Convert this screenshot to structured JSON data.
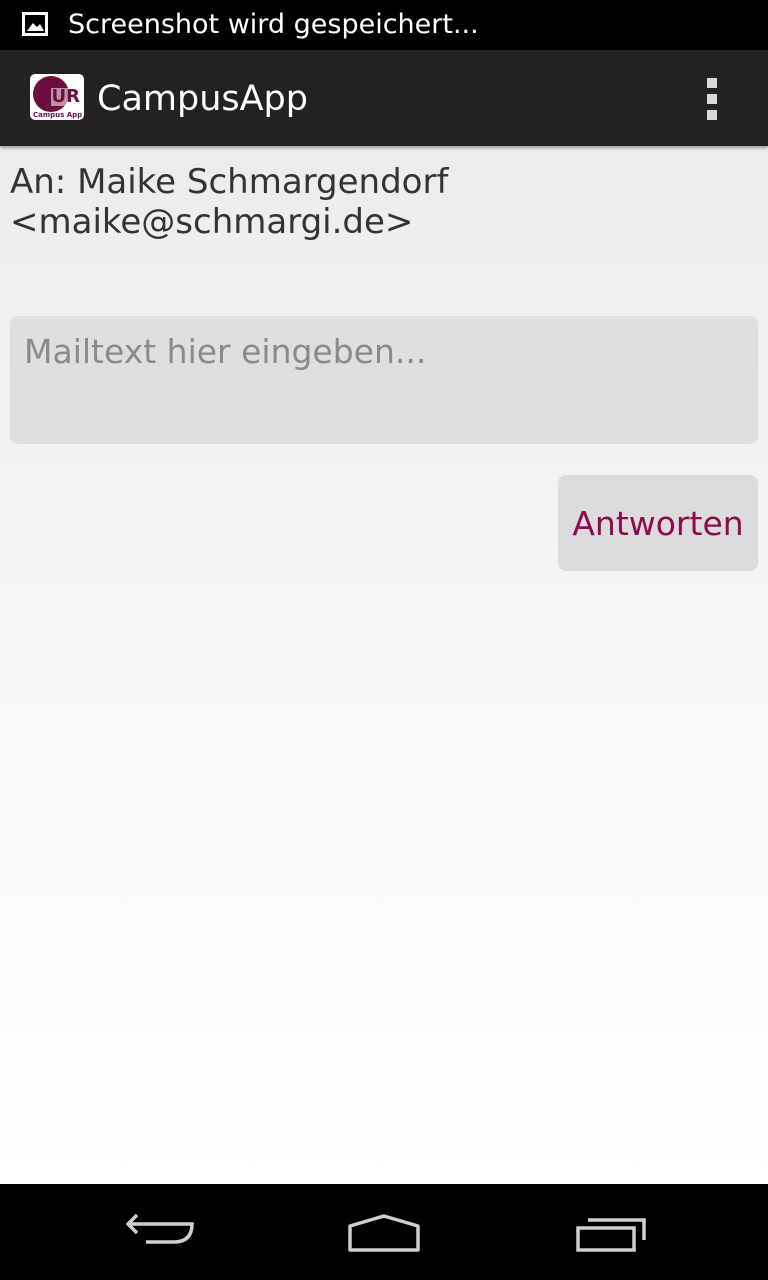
{
  "status_bar": {
    "notification_icon": "image-icon",
    "text": "Screenshot wird gespeichert..."
  },
  "action_bar": {
    "logo": {
      "icon": "campus-app-logo",
      "mark_text": "UR",
      "sub_text": "Campus App"
    },
    "title": "CampusApp",
    "overflow_icon": "more-vert-icon"
  },
  "compose": {
    "recipient_line": "An: Maike Schmargendorf <maike@schmargi.de>",
    "message_value": "",
    "message_placeholder": "Mailtext hier eingeben...",
    "reply_button_label": "Antworten"
  },
  "navigation_bar": {
    "back_icon": "back-icon",
    "home_icon": "home-icon",
    "recent_icon": "recent-apps-icon"
  },
  "colors": {
    "accent": "#8e0b4f",
    "logo": "#6d0f3c",
    "action_bar": "#222222",
    "input_background": "#dfdfdf"
  }
}
